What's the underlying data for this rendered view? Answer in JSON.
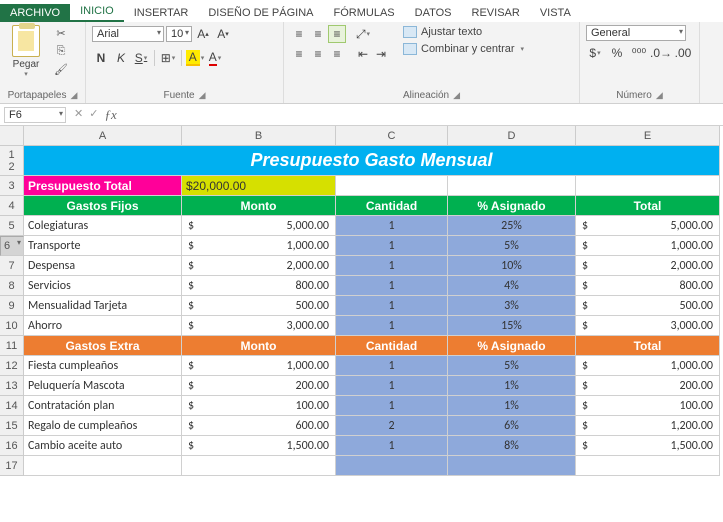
{
  "tabs": {
    "file": "ARCHIVO",
    "home": "INICIO",
    "insert": "INSERTAR",
    "layout": "DISEÑO DE PÁGINA",
    "formulas": "FÓRMULAS",
    "data": "DATOS",
    "review": "REVISAR",
    "view": "VISTA"
  },
  "ribbon": {
    "paste": "Pegar",
    "clipboard_label": "Portapapeles",
    "font_name": "Arial",
    "font_size": "10",
    "font_label": "Fuente",
    "wrap": "Ajustar texto",
    "merge": "Combinar y centrar",
    "align_label": "Alineación",
    "number_format": "General",
    "number_label": "Número"
  },
  "namebox": "F6",
  "colA": "A",
  "colB": "B",
  "colC": "C",
  "colD": "D",
  "colE": "E",
  "title": "Presupuesto Gasto Mensual",
  "budget_label": "Presupuesto Total",
  "budget_value": "$20,000.00",
  "hdr1": {
    "a": "Gastos Fijos",
    "b": "Monto",
    "c": "Cantidad",
    "d": "% Asignado",
    "e": "Total"
  },
  "hdr2": {
    "a": "Gastos Extra",
    "b": "Monto",
    "c": "Cantidad",
    "d": "% Asignado",
    "e": "Total"
  },
  "fix": [
    {
      "a": "Colegiaturas",
      "b": "5,000.00",
      "c": "1",
      "d": "25%",
      "e": "5,000.00"
    },
    {
      "a": "Transporte",
      "b": "1,000.00",
      "c": "1",
      "d": "5%",
      "e": "1,000.00"
    },
    {
      "a": "Despensa",
      "b": "2,000.00",
      "c": "1",
      "d": "10%",
      "e": "2,000.00"
    },
    {
      "a": "Servicios",
      "b": "800.00",
      "c": "1",
      "d": "4%",
      "e": "800.00"
    },
    {
      "a": "Mensualidad Tarjeta",
      "b": "500.00",
      "c": "1",
      "d": "3%",
      "e": "500.00"
    },
    {
      "a": "Ahorro",
      "b": "3,000.00",
      "c": "1",
      "d": "15%",
      "e": "3,000.00"
    }
  ],
  "ext": [
    {
      "a": "Fiesta cumpleaños",
      "b": "1,000.00",
      "c": "1",
      "d": "5%",
      "e": "1,000.00"
    },
    {
      "a": "Peluquería Mascota",
      "b": "200.00",
      "c": "1",
      "d": "1%",
      "e": "200.00"
    },
    {
      "a": "Contratación plan",
      "b": "100.00",
      "c": "1",
      "d": "1%",
      "e": "100.00"
    },
    {
      "a": "Regalo de cumpleaños",
      "b": "600.00",
      "c": "2",
      "d": "6%",
      "e": "1,200.00"
    },
    {
      "a": "Cambio aceite auto",
      "b": "1,500.00",
      "c": "1",
      "d": "8%",
      "e": "1,500.00"
    }
  ],
  "cur": "$"
}
